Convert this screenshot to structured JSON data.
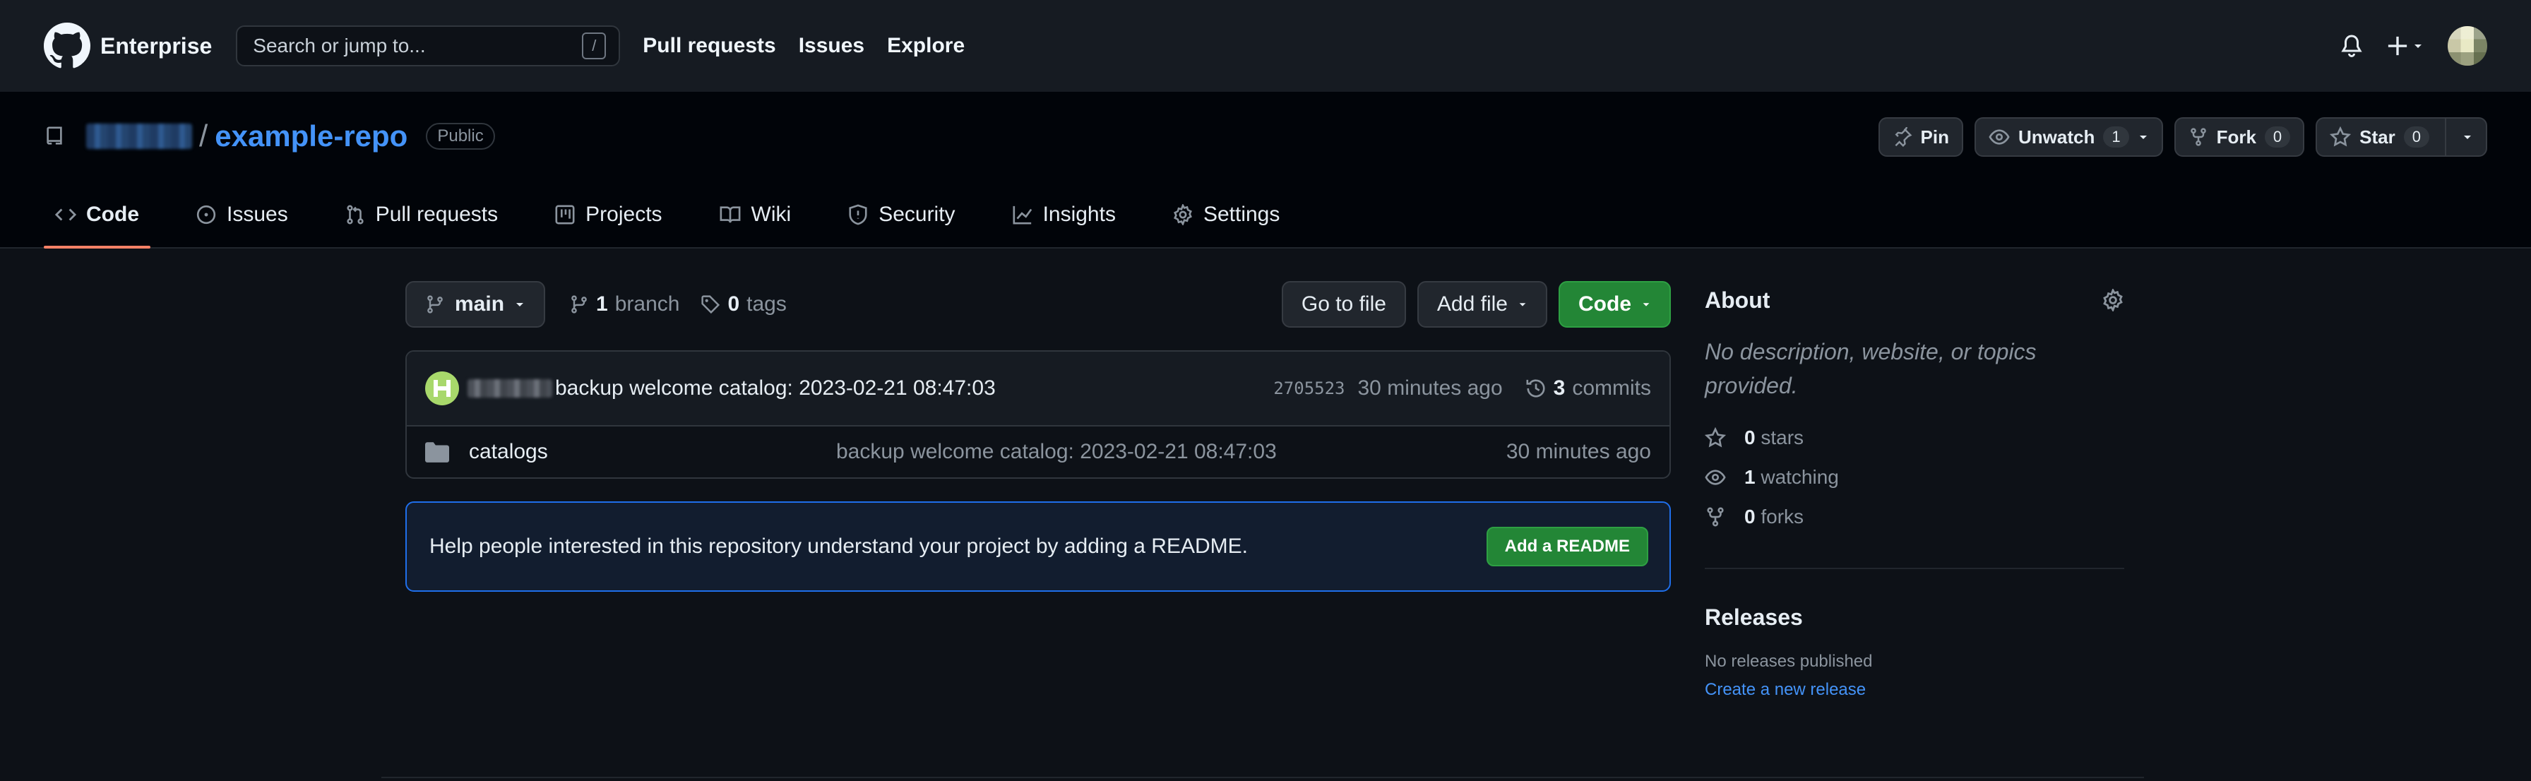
{
  "header": {
    "brand": "Enterprise",
    "search_placeholder": "Search or jump to...",
    "search_shortcut": "/",
    "nav": [
      "Pull requests",
      "Issues",
      "Explore"
    ]
  },
  "repo": {
    "separator": "/",
    "name": "example-repo",
    "visibility": "Public",
    "actions": {
      "pin": "Pin",
      "unwatch": "Unwatch",
      "watch_count": "1",
      "fork": "Fork",
      "fork_count": "0",
      "star": "Star",
      "star_count": "0"
    },
    "tabs": [
      "Code",
      "Issues",
      "Pull requests",
      "Projects",
      "Wiki",
      "Security",
      "Insights",
      "Settings"
    ]
  },
  "main": {
    "branch": "main",
    "branch_count": "1",
    "branch_label": "branch",
    "tag_count": "0",
    "tag_label": "tags",
    "go_to_file": "Go to file",
    "add_file": "Add file",
    "code_btn": "Code",
    "latest_commit": {
      "message": "backup welcome catalog: 2023-02-21 08:47:03",
      "sha": "2705523",
      "age": "30 minutes ago",
      "commit_count": "3",
      "commit_label": "commits"
    },
    "files": [
      {
        "name": "catalogs",
        "message": "backup welcome catalog: 2023-02-21 08:47:03",
        "age": "30 minutes ago"
      }
    ],
    "readme_prompt": "Help people interested in this repository understand your project by adding a README.",
    "readme_btn": "Add a README"
  },
  "sidebar": {
    "about_title": "About",
    "description": "No description, website, or topics provided.",
    "stars": {
      "count": "0",
      "label": "stars"
    },
    "watching": {
      "count": "1",
      "label": "watching"
    },
    "forks": {
      "count": "0",
      "label": "forks"
    },
    "releases_title": "Releases",
    "no_releases": "No releases published",
    "create_release": "Create a new release"
  },
  "colors": {
    "accent_link": "#4493f8",
    "active_tab": "#f78166",
    "primary_button": "#238636",
    "background": "#0d1117"
  }
}
